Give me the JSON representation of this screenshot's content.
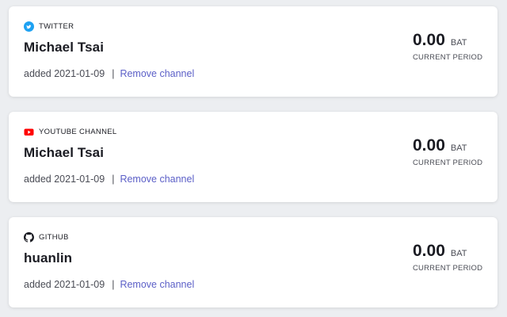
{
  "channels": [
    {
      "platform": "TWITTER",
      "icon": "twitter-icon",
      "icon_color": "#1da1f2",
      "name": "Michael Tsai",
      "added": "added 2021-01-09",
      "separator": "|",
      "remove_label": "Remove channel",
      "amount": "0.00",
      "currency": "BAT",
      "period": "CURRENT PERIOD"
    },
    {
      "platform": "YOUTUBE CHANNEL",
      "icon": "youtube-icon",
      "icon_color": "#ff0000",
      "name": "Michael Tsai",
      "added": "added 2021-01-09",
      "separator": "|",
      "remove_label": "Remove channel",
      "amount": "0.00",
      "currency": "BAT",
      "period": "CURRENT PERIOD"
    },
    {
      "platform": "GITHUB",
      "icon": "github-icon",
      "icon_color": "#1a1b22",
      "name": "huanlin",
      "added": "added 2021-01-09",
      "separator": "|",
      "remove_label": "Remove channel",
      "amount": "0.00",
      "currency": "BAT",
      "period": "CURRENT PERIOD"
    }
  ],
  "colors": {
    "background": "#eceef1",
    "card": "#ffffff",
    "link": "#5b5fc7",
    "text": "#1a1b22",
    "muted": "#4a4c55"
  }
}
